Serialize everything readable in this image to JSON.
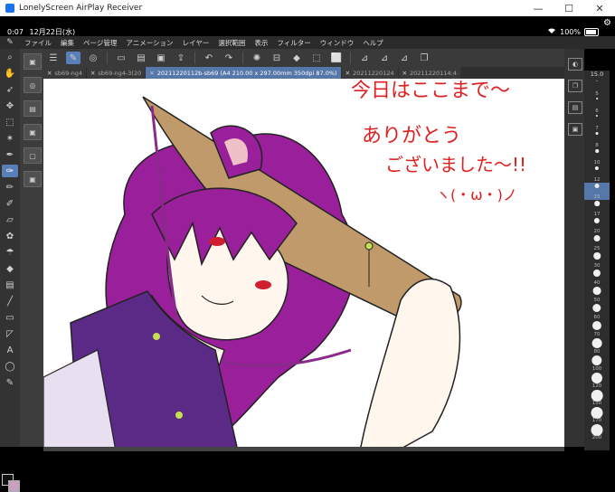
{
  "window": {
    "title": "LonelyScreen AirPlay Receiver",
    "controls": [
      "—",
      "☐",
      "✕"
    ]
  },
  "status": {
    "time": "0:07",
    "date": "12月22日(水)",
    "battery": "100%"
  },
  "menu": {
    "items": [
      "ファイル",
      "編集",
      "ページ管理",
      "アニメーション",
      "レイヤー",
      "選択範囲",
      "表示",
      "フィルター",
      "ウィンドウ",
      "ヘルプ"
    ]
  },
  "tabs": [
    {
      "label": "sb69-ng4",
      "active": false
    },
    {
      "label": "sb69-ng4-3(20",
      "active": false
    },
    {
      "label": "20211220112b-sb69 (A4 210.00 x 297.00mm 350dpi 87.0%)",
      "active": true
    },
    {
      "label": "20211220124",
      "active": false
    },
    {
      "label": "20211220114:4",
      "active": false
    }
  ],
  "brush_header": "15.0",
  "brush_sizes": [
    "5",
    "6",
    "7",
    "8",
    "10",
    "12",
    "15",
    "17",
    "20",
    "25",
    "30",
    "40",
    "50",
    "60",
    "70",
    "80",
    "100",
    "120",
    "150",
    "170",
    "200"
  ],
  "brush_selected": "15",
  "handwritten": {
    "line1": "今日はここまで〜",
    "line2": "ありがとう",
    "line3": "ございました〜!!",
    "line4": "ヽ(・ω・)ノ"
  },
  "colors": {
    "hair": "#9a1f9a",
    "hat": "#c19a6b",
    "vest": "#5b2a86",
    "accent_ui": "#5577aa"
  }
}
